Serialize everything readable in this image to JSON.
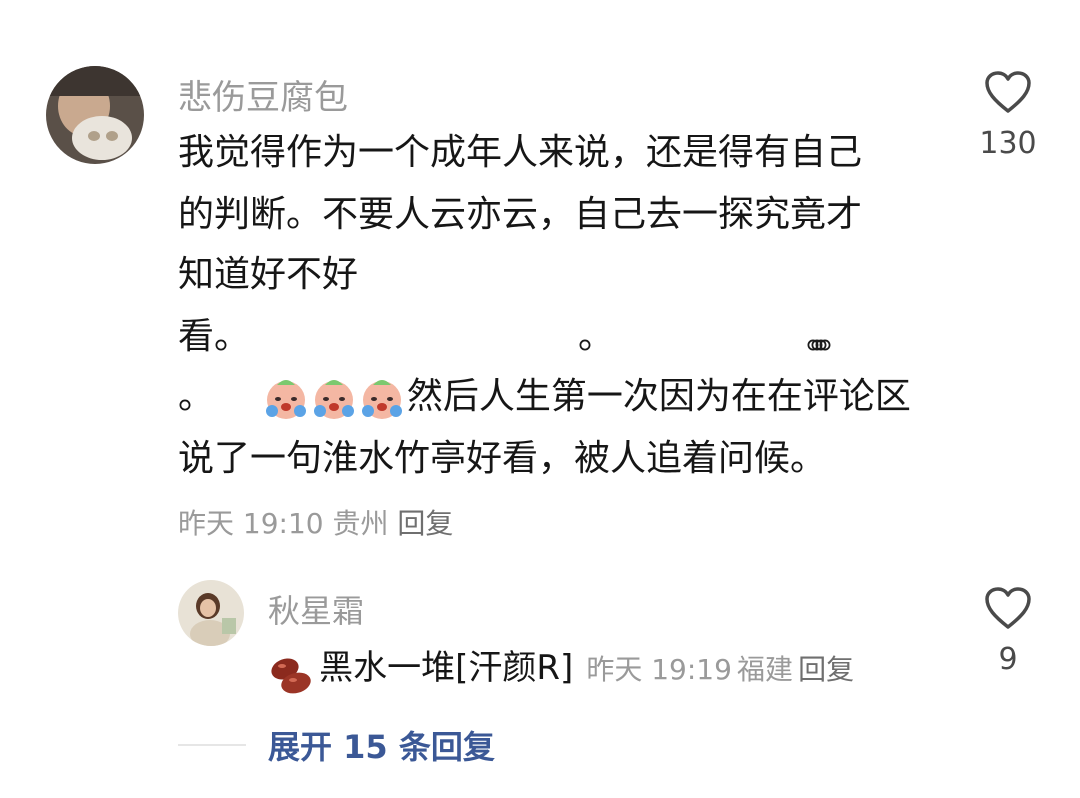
{
  "comment": {
    "username": "悲伤豆腐包",
    "lines": [
      "我觉得作为一个成年人来说，还是得有自己",
      "的判断。不要人云亦云，自己去一探究竟才",
      "知道好不好",
      "看。"
    ],
    "line5_prefix": "。",
    "line5_text": "然后人生第一次因为在在评论区",
    "line6": "说了一句淮水竹亭好看，被人追着问候。",
    "dot_single": "。",
    "dots_group": "。。。。",
    "meta_time": "昨天 19:10",
    "meta_location": "贵州",
    "reply_label": "回复",
    "like_count": "130",
    "emoji_name": "crying-face-icon"
  },
  "reply": {
    "username": "秋星霜",
    "text": "黑水一堆[汗颜R]",
    "meta_time": "昨天 19:19",
    "meta_location": "福建",
    "reply_label": "回复",
    "like_count": "9",
    "emoji_name": "red-bean-icon"
  },
  "expand_label": "展开 15 条回复",
  "colors": {
    "username": "#9a9a9a",
    "text": "#161616",
    "expand": "#3b5896"
  }
}
